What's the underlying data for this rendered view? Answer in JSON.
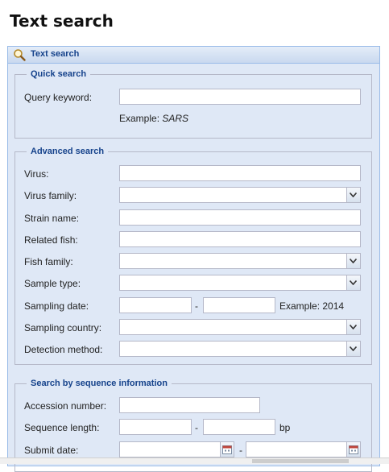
{
  "page": {
    "title": "Text search"
  },
  "panel": {
    "title": "Text search",
    "icon": "magnifier-icon"
  },
  "quick": {
    "legend": "Quick search",
    "keyword_label": "Query keyword:",
    "keyword_value": "",
    "example_prefix": "Example: ",
    "example_value": "SARS"
  },
  "advanced": {
    "legend": "Advanced search",
    "virus_label": "Virus:",
    "virus_family_label": "Virus family:",
    "strain_label": "Strain name:",
    "related_fish_label": "Related fish:",
    "fish_family_label": "Fish family:",
    "sample_type_label": "Sample type:",
    "sampling_date_label": "Sampling date:",
    "sampling_date_sep": "-",
    "sampling_date_example": "Example: 2014",
    "sampling_country_label": "Sampling country:",
    "detection_method_label": "Detection method:"
  },
  "sequence": {
    "legend": "Search by sequence information",
    "accession_label": "Accession number:",
    "length_label": "Sequence length:",
    "length_sep": "-",
    "length_unit": "bp",
    "submit_date_label": "Submit date:",
    "submit_date_sep": "-"
  },
  "icons": {
    "dropdown": "chevron-down-icon",
    "calendar": "calendar-icon"
  },
  "colors": {
    "panel_bg": "#dfe8f6",
    "panel_border": "#99bbe8",
    "header_text": "#15428b"
  }
}
